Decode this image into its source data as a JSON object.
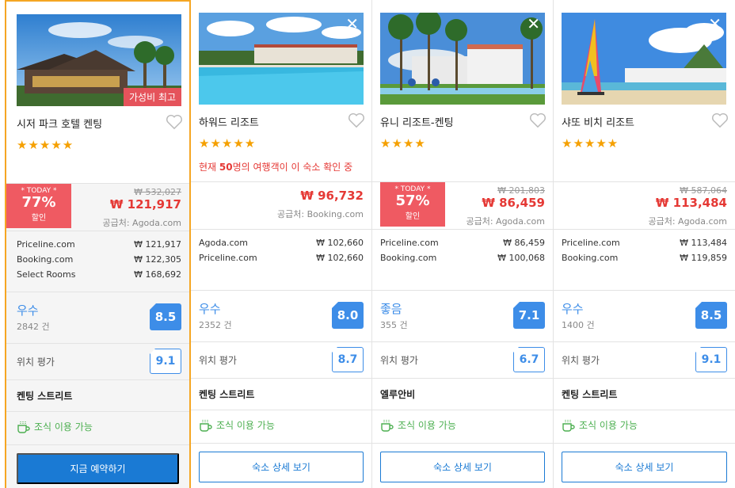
{
  "currency": "₩",
  "hotels": [
    {
      "name": "시저 파크 호텔 켄팅",
      "stars": "★★★★★",
      "ribbon": "가성비 최고",
      "show_close": false,
      "notice": null,
      "today": {
        "label": "* TODAY *",
        "percent": "77%",
        "word": "할인"
      },
      "old_price": "₩ 532,027",
      "new_price": "₩ 121,917",
      "supplier": "공급처: Agoda.com",
      "deals": [
        {
          "site": "Priceline.com",
          "price": "₩  121,917"
        },
        {
          "site": "Booking.com",
          "price": "₩  122,305"
        },
        {
          "site": "Select Rooms",
          "price": "₩  168,692"
        }
      ],
      "rating_label": "우수",
      "rating_count": "2842 건",
      "rating_score": "8.5",
      "location_label": "위치 평가",
      "location_score": "9.1",
      "area": "켄팅 스트리트",
      "breakfast": "조식 이용 가능",
      "button": "지금 예약하기"
    },
    {
      "name": "하워드 리조트",
      "stars": "★★★★★",
      "ribbon": null,
      "show_close": true,
      "notice": {
        "pre": "현재 ",
        "bold": "50",
        "post": "명의 여행객이 이 숙소 확인 중"
      },
      "today": null,
      "old_price": null,
      "new_price": "₩ 96,732",
      "supplier": "공급처: Booking.com",
      "deals": [
        {
          "site": "Agoda.com",
          "price": "₩  102,660"
        },
        {
          "site": "Priceline.com",
          "price": "₩  102,660"
        }
      ],
      "rating_label": "우수",
      "rating_count": "2352 건",
      "rating_score": "8.0",
      "location_label": "위치 평가",
      "location_score": "8.7",
      "area": "켄팅 스트리트",
      "breakfast": "조식 이용 가능",
      "button": "숙소 상세 보기"
    },
    {
      "name": "유니 리조트-켄팅",
      "stars": "★★★★",
      "ribbon": null,
      "show_close": true,
      "notice": null,
      "today": {
        "label": "* TODAY *",
        "percent": "57%",
        "word": "할인"
      },
      "old_price": "₩ 201,803",
      "new_price": "₩ 86,459",
      "supplier": "공급처: Agoda.com",
      "deals": [
        {
          "site": "Priceline.com",
          "price": "₩    86,459"
        },
        {
          "site": "Booking.com",
          "price": "₩  100,068"
        }
      ],
      "rating_label": "좋음",
      "rating_count": "355 건",
      "rating_score": "7.1",
      "location_label": "위치 평가",
      "location_score": "6.7",
      "area": "엘루안비",
      "breakfast": "조식 이용 가능",
      "button": "숙소 상세 보기"
    },
    {
      "name": "샤또 비치 리조트",
      "stars": "★★★★★",
      "ribbon": null,
      "show_close": true,
      "notice": null,
      "today": null,
      "old_price": "₩ 587,064",
      "new_price": "₩ 113,484",
      "supplier": "공급처: Agoda.com",
      "deals": [
        {
          "site": "Priceline.com",
          "price": "₩  113,484"
        },
        {
          "site": "Booking.com",
          "price": "₩  119,859"
        }
      ],
      "rating_label": "우수",
      "rating_count": "1400 건",
      "rating_score": "8.5",
      "location_label": "위치 평가",
      "location_score": "9.1",
      "area": "켄팅 스트리트",
      "breakfast": "조식 이용 가능",
      "button": "숙소 상세 보기"
    }
  ],
  "colors": {
    "highlight_border": "#f5a623",
    "discount_red": "#ef5a62",
    "price_red": "#e53935",
    "rating_blue": "#3d8de8",
    "button_blue": "#1a7ad4",
    "breakfast_green": "#4caf50",
    "star_orange": "#f5a000"
  },
  "icons": {
    "close": "close-icon",
    "heart": "heart-icon",
    "breakfast": "coffee-cup-icon"
  }
}
